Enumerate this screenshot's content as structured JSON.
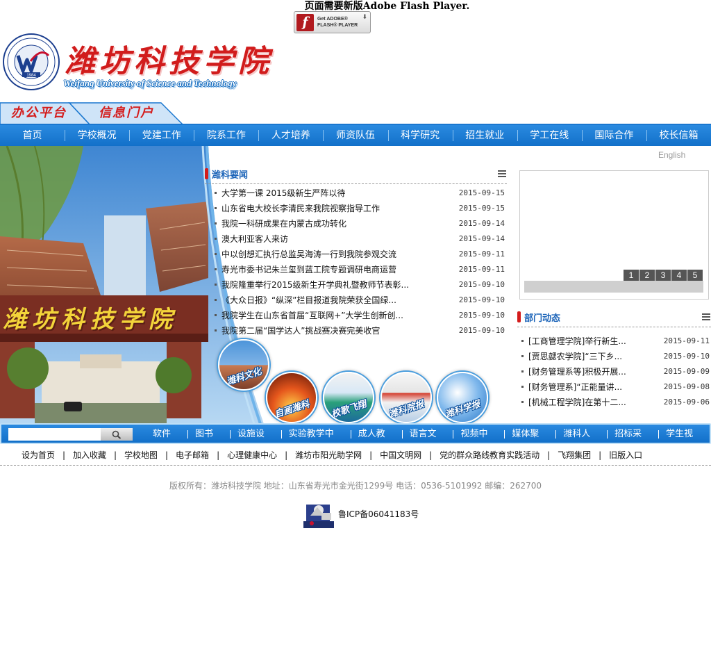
{
  "flash": {
    "message": "页面需要新版Adobe Flash Player.",
    "badge_line1": "Get ADOBE®",
    "badge_line2": "FLASH® PLAYER"
  },
  "logo": {
    "name_cn": "潍坊科技学院",
    "name_en": "Weifang University of Science and Technology",
    "year": "1984"
  },
  "portal_tabs": [
    "办公平台",
    "信息门户"
  ],
  "main_nav": [
    "首页",
    "学校概况",
    "党建工作",
    "院系工作",
    "人才培养",
    "师资队伍",
    "科学研究",
    "招生就业",
    "学工在线",
    "国际合作",
    "校长信箱"
  ],
  "campus_sign": "潍坊科技学院",
  "circle_buttons": [
    "潍科文化",
    "自画潍科",
    "校歌飞翔",
    "潍科院报",
    "潍科学报"
  ],
  "english_link": "English",
  "news": {
    "title": "潍科要闻",
    "items": [
      {
        "title": "大学第一课  2015级新生严阵以待",
        "date": "2015-09-15"
      },
      {
        "title": "山东省电大校长李清民来我院视察指导工作",
        "date": "2015-09-15"
      },
      {
        "title": "我院一科研成果在内蒙古成功转化",
        "date": "2015-09-14"
      },
      {
        "title": "澳大利亚客人来访",
        "date": "2015-09-14"
      },
      {
        "title": "中以创想汇执行总监吴海涛一行到我院参观交流",
        "date": "2015-09-11"
      },
      {
        "title": "寿光市委书记朱兰玺到蓝工院专题调研电商运营",
        "date": "2015-09-11"
      },
      {
        "title": "我院隆重举行2015级新生开学典礼暨教师节表彰...",
        "date": "2015-09-10"
      },
      {
        "title": "《大众日报》“纵深”栏目报道我院荣获全国绿...",
        "date": "2015-09-10"
      },
      {
        "title": "我院学生在山东省首届“互联网+”大学生创新创...",
        "date": "2015-09-10"
      },
      {
        "title": "我院第二届“国学达人”挑战赛决赛完美收官",
        "date": "2015-09-10"
      }
    ]
  },
  "slideshow": {
    "pages": [
      "1",
      "2",
      "3",
      "4",
      "5"
    ]
  },
  "dept_news": {
    "title": "部门动态",
    "items": [
      {
        "title": "[工商管理学院]举行新生...",
        "date": "2015-09-11"
      },
      {
        "title": "[贾思勰农学院]“三下乡...",
        "date": "2015-09-10"
      },
      {
        "title": "[财务管理系等]积极开展...",
        "date": "2015-09-09"
      },
      {
        "title": "[财务管理系]“正能量讲...",
        "date": "2015-09-08"
      },
      {
        "title": "[机械工程学院]在第十二...",
        "date": "2015-09-06"
      }
    ]
  },
  "search": {
    "placeholder": ""
  },
  "quick_links": [
    "软件园",
    "图书馆",
    "设施设备",
    "实验教学中心",
    "成人教育",
    "语言文字",
    "视频中心",
    "媒体聚焦",
    "潍科人物",
    "招标采购",
    "学生视界"
  ],
  "footer_links": [
    "设为首页",
    "加入收藏",
    "学校地图",
    "电子邮箱",
    "心理健康中心",
    "潍坊市阳光助学网",
    "中国文明网",
    "党的群众路线教育实践活动",
    "飞翔集团",
    "旧版入口"
  ],
  "copyright": "版权所有：潍坊科技学院  地址：山东省寿光市金光街1299号  电话：0536-5101992  邮编：262700",
  "icp": "鲁ICP备06041183号",
  "colors": {
    "nav_blue": "#1a77cf",
    "brand_red": "#d11c1c",
    "title_blue": "#1a63b8"
  }
}
